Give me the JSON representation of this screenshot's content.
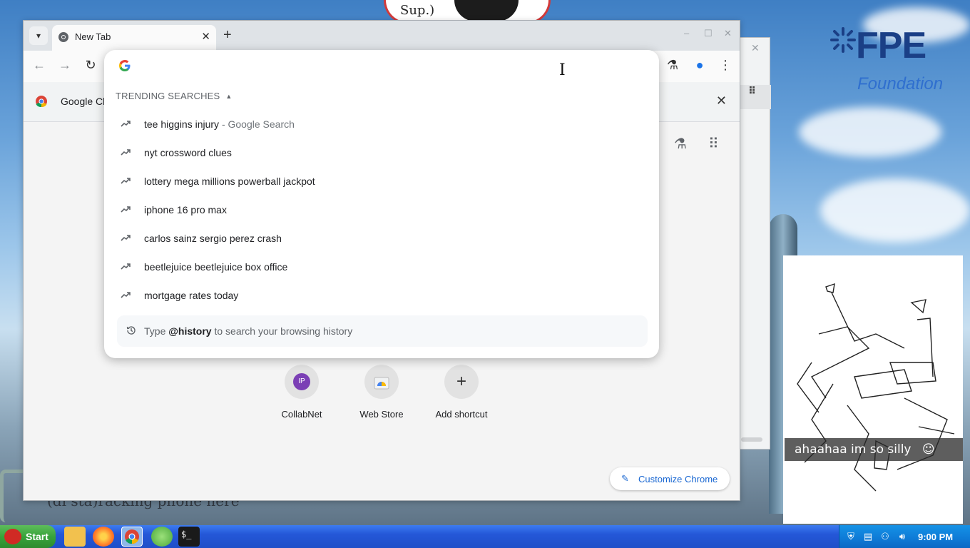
{
  "desktop": {
    "sticker_text": "Sup.)",
    "logo_text": "FPE",
    "logo_subtitle": "Foundation",
    "drawing_caption": "ahaahaa im so silly",
    "camera_overlay_text": "(di sta)racking phone here"
  },
  "browser": {
    "tab_title": "New Tab",
    "infobar_text": "Google Ch",
    "omnibox": {
      "section_title": "TRENDING SEARCHES",
      "suggestions": [
        {
          "text": "tee higgins injury",
          "suffix": " - Google Search"
        },
        {
          "text": "nyt crossword clues",
          "suffix": ""
        },
        {
          "text": "lottery mega millions powerball jackpot",
          "suffix": ""
        },
        {
          "text": "iphone 16 pro max",
          "suffix": ""
        },
        {
          "text": "carlos sainz sergio perez crash",
          "suffix": ""
        },
        {
          "text": "beetlejuice beetlejuice box office",
          "suffix": ""
        },
        {
          "text": "mortgage rates today",
          "suffix": ""
        }
      ],
      "history_prefix": "Type ",
      "history_keyword": "@history",
      "history_suffix": " to search your browsing history"
    },
    "shortcuts": [
      {
        "label": "CollabNet",
        "initials": "IP"
      },
      {
        "label": "Web Store"
      },
      {
        "label": "Add shortcut"
      }
    ],
    "customize_label": "Customize Chrome"
  },
  "taskbar": {
    "start_label": "Start",
    "clock": "9:00 PM"
  },
  "colors": {
    "taskbar_blue": "#2457d8",
    "start_green": "#37a33a",
    "tray_blue": "#0e7ad6",
    "link_blue": "#1967d2",
    "shortcut_purple": "#7b3fb5"
  }
}
